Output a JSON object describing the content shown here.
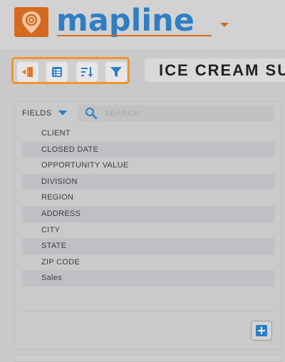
{
  "brand": {
    "name": "mapline",
    "accent": "#d4691f",
    "primary": "#2f7ec4"
  },
  "header": {
    "dropdown_icon": "caret-down-icon"
  },
  "toolbar": {
    "buttons": [
      {
        "icon": "collapse-panel-icon"
      },
      {
        "icon": "table-view-icon"
      },
      {
        "icon": "sort-icon"
      },
      {
        "icon": "filter-icon"
      }
    ],
    "highlight_color": "#f0962e"
  },
  "map_title": "ICE CREAM SU",
  "fields_panel": {
    "label": "FIELDS",
    "search_placeholder": "SEARCH",
    "items": [
      "CLIENT",
      "CLOSED DATE",
      "OPPORTUNITY VALUE",
      "DIVISION",
      "REGION",
      "ADDRESS",
      "CITY",
      "STATE",
      "ZIP CODE",
      "Sales"
    ],
    "add_button_icon": "plus-icon"
  }
}
